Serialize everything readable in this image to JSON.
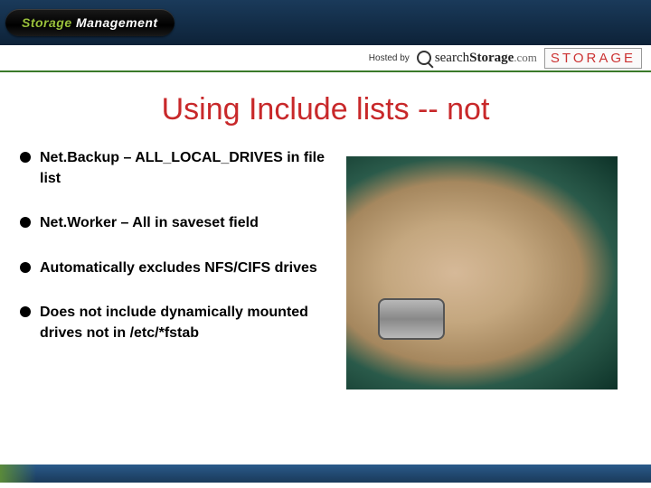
{
  "header": {
    "brand_prefix": "Storage",
    "brand_suffix": " Management"
  },
  "subheader": {
    "hosted_by": "Hosted by",
    "search_prefix": "search",
    "search_bold": "Storage",
    "search_suffix": ".com",
    "storage_logo": "STORAGE"
  },
  "title": "Using Include lists -- not",
  "bullets": [
    "Net.Backup – ALL_LOCAL_DRIVES in file list",
    "Net.Worker – All in saveset field",
    "Automatically excludes NFS/CIFS drives",
    "Does not include dynamically mounted drives not in /etc/*fstab"
  ]
}
